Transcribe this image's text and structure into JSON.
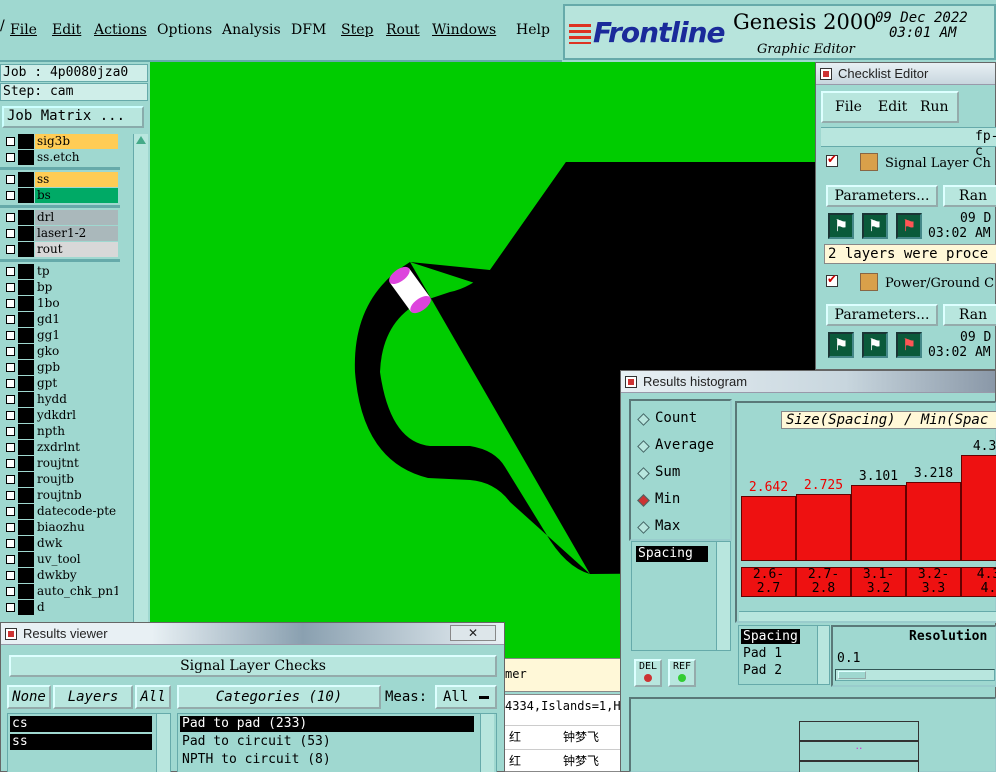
{
  "menu": {
    "items": [
      "File",
      "Edit",
      "Actions",
      "Options",
      "Analysis",
      "DFM",
      "Step",
      "Rout",
      "Windows",
      "Help"
    ],
    "partial_glyph": "/"
  },
  "logo": {
    "brand": "Frontline",
    "product": "Genesis 2000",
    "subtitle": "Graphic Editor",
    "date": "09 Dec 2022",
    "time": "03:01 AM"
  },
  "job": {
    "job_line": "Job : 4p0080jza0",
    "step_line": "Step: cam",
    "matrix_button": "Job Matrix ..."
  },
  "layers": [
    {
      "name": "sig3b",
      "color": "#ffcc55"
    },
    {
      "name": "ss.etch",
      "color": "#9fd8d0"
    },
    {
      "name": "ss",
      "color": "#ffcc55"
    },
    {
      "name": "bs",
      "color": "#00aa66"
    },
    {
      "name": "drl",
      "color": "#aab8bb"
    },
    {
      "name": "laser1-2",
      "color": "#aab8bb"
    },
    {
      "name": "rout",
      "color": "#d8d8d8"
    },
    {
      "name": "tp",
      "color": "#9fd8d0"
    },
    {
      "name": "bp",
      "color": "#9fd8d0"
    },
    {
      "name": "1bo",
      "color": "#9fd8d0"
    },
    {
      "name": "gd1",
      "color": "#9fd8d0"
    },
    {
      "name": "gg1",
      "color": "#9fd8d0"
    },
    {
      "name": "gko",
      "color": "#9fd8d0"
    },
    {
      "name": "gpb",
      "color": "#9fd8d0"
    },
    {
      "name": "gpt",
      "color": "#9fd8d0"
    },
    {
      "name": "hydd",
      "color": "#9fd8d0"
    },
    {
      "name": "ydkdrl",
      "color": "#9fd8d0"
    },
    {
      "name": "npth",
      "color": "#9fd8d0"
    },
    {
      "name": "zxdrlnt",
      "color": "#9fd8d0"
    },
    {
      "name": "roujtnt",
      "color": "#9fd8d0"
    },
    {
      "name": "roujtb",
      "color": "#9fd8d0"
    },
    {
      "name": "roujtnb",
      "color": "#9fd8d0"
    },
    {
      "name": "datecode-pte",
      "color": "#9fd8d0"
    },
    {
      "name": "biaozhu",
      "color": "#9fd8d0"
    },
    {
      "name": "dwk",
      "color": "#9fd8d0"
    },
    {
      "name": "uv_tool",
      "color": "#9fd8d0"
    },
    {
      "name": "dwkby",
      "color": "#9fd8d0"
    },
    {
      "name": "auto_chk_pn1",
      "color": "#9fd8d0"
    },
    {
      "name": "d",
      "color": "#9fd8d0"
    }
  ],
  "checklist": {
    "title": "Checklist Editor",
    "menu": [
      "File",
      "Edit",
      "Run"
    ],
    "name_field": "fp-c",
    "items": [
      {
        "label": "Signal Layer Ch",
        "params_button": "Parameters...",
        "run_button": "Ran",
        "date": "09 D",
        "time": "03:02 AM",
        "message": "2 layers were proce"
      },
      {
        "label": "Power/Ground C",
        "params_button": "Parameters...",
        "run_button": "Ran",
        "date": "09 D",
        "time": "03:02 AM"
      }
    ]
  },
  "histogram": {
    "title": "Results histogram",
    "options": [
      "Count",
      "Average",
      "Sum",
      "Min",
      "Max"
    ],
    "selected_option": "Min",
    "measure_list": [
      "Spacing"
    ],
    "header": "Size(Spacing) / Min(Spac",
    "del_button": "DEL",
    "ref_button": "REF",
    "lower_list": [
      "Spacing",
      "Pad 1",
      "Pad 2"
    ],
    "resolution_label": "Resolution",
    "resolution_value": "0.1"
  },
  "chart_data": {
    "type": "bar",
    "title": "Size(Spacing) / Min(Spac",
    "categories": [
      "2.6-2.7",
      "2.7-2.8",
      "3.1-3.2",
      "3.2-3.3",
      "4.3-4."
    ],
    "values": [
      2.642,
      2.725,
      3.101,
      3.218,
      4.3
    ],
    "value_labels": [
      "2.642",
      "2.725",
      "3.101",
      "3.218",
      "4.30"
    ],
    "range_top": [
      "2.6-",
      "2.7-",
      "3.1-",
      "3.2-",
      "4.3"
    ],
    "range_bottom": [
      "2.7",
      "2.8",
      "3.2",
      "3.3",
      "4."
    ],
    "ylim": [
      0,
      4.5
    ],
    "bar_color": "#ee1111"
  },
  "results_viewer": {
    "title": "Results viewer",
    "header": "Signal Layer Checks",
    "none_button": "None",
    "layers_label": "Layers",
    "all_button": "All",
    "categories_label": "Categories (10)",
    "meas_label": "Meas:",
    "meas_value": "All",
    "layers": [
      "cs",
      "ss"
    ],
    "categories": [
      "Pad to pad (233)",
      "Pad to circuit (53)",
      "NPTH to circuit (8)"
    ]
  },
  "status_strip": {
    "line1": "mer",
    "line2": "4334,Islands=1,H",
    "rows": [
      [
        "红",
        "钟梦飞"
      ],
      [
        "红",
        "钟梦飞"
      ]
    ]
  },
  "colors": {
    "panel": "#9fd8d0",
    "canvas": "#00cc00",
    "trace": "#000000",
    "highlight": "#dd44dd"
  }
}
